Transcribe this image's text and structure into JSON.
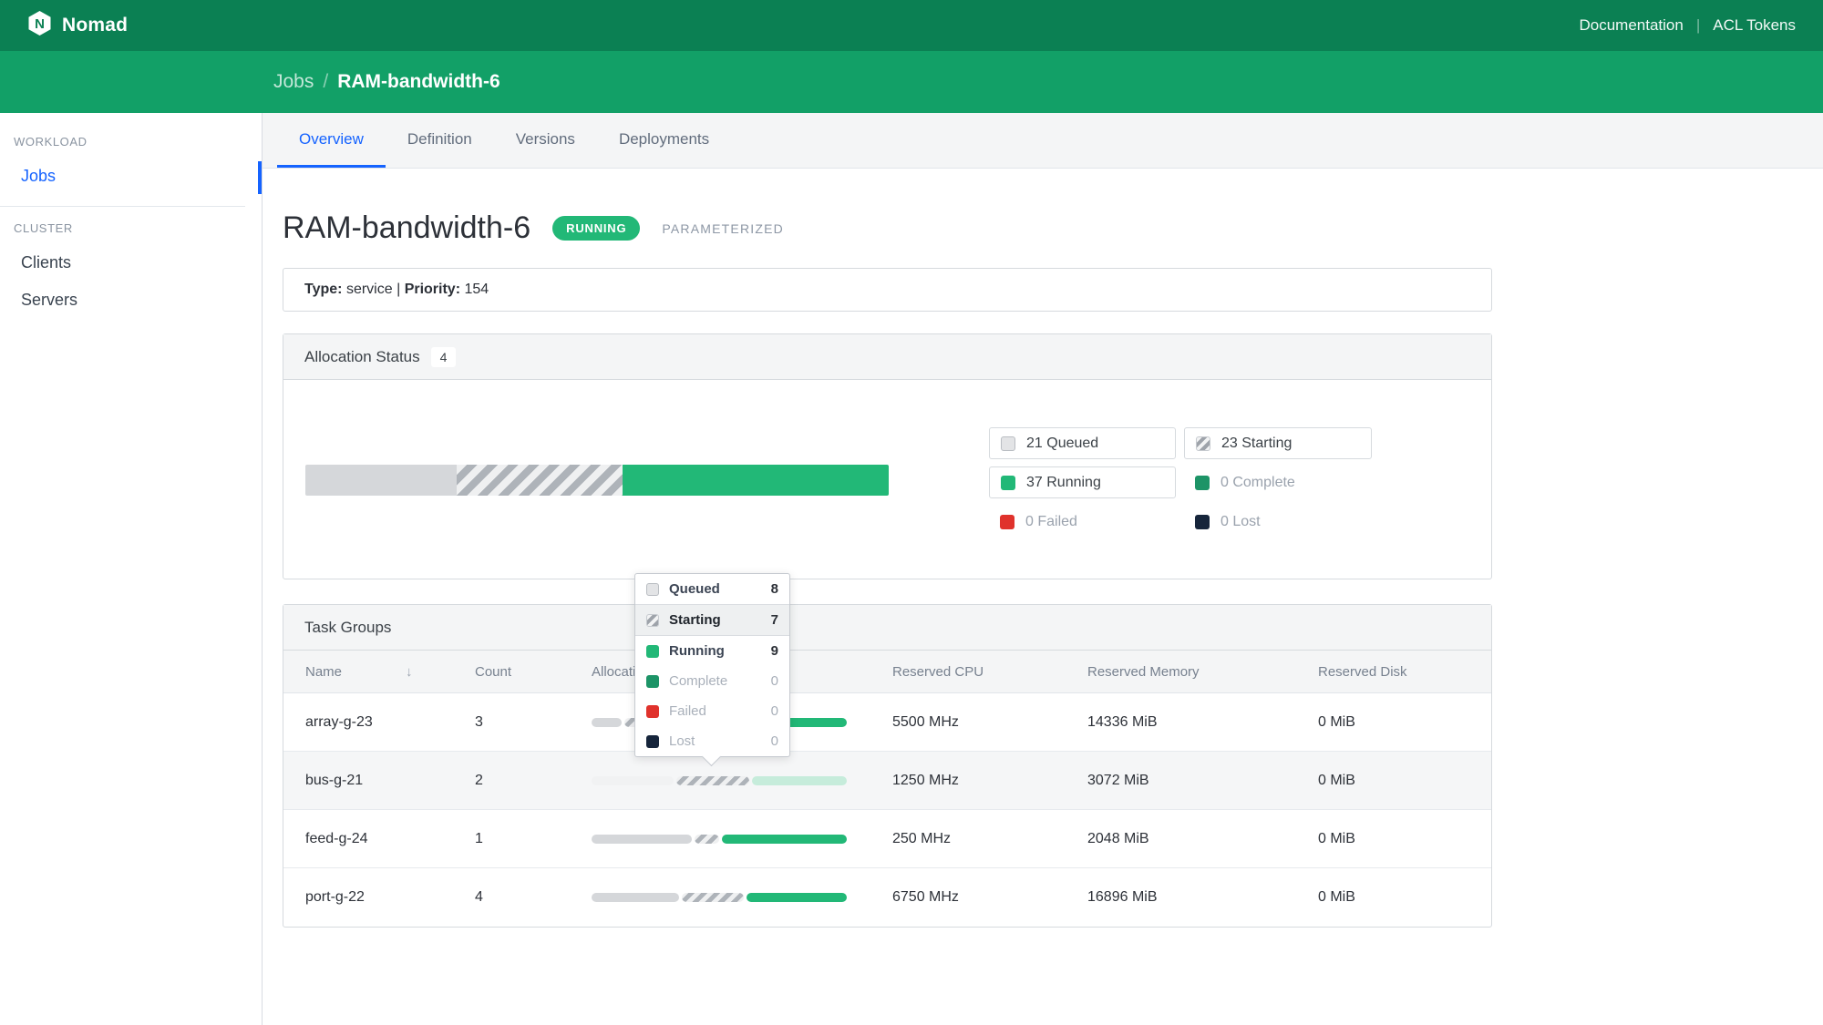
{
  "navbar": {
    "brand": "Nomad",
    "links": [
      {
        "label": "Documentation"
      },
      {
        "label": "ACL Tokens"
      }
    ],
    "separator": "|"
  },
  "breadcrumb": {
    "parent": "Jobs",
    "separator": "/",
    "current": "RAM-bandwidth-6"
  },
  "sidebar": {
    "sections": [
      {
        "label": "WORKLOAD",
        "items": [
          {
            "label": "Jobs",
            "active": true
          }
        ]
      },
      {
        "label": "CLUSTER",
        "items": [
          {
            "label": "Clients"
          },
          {
            "label": "Servers"
          }
        ]
      }
    ]
  },
  "tabs": [
    {
      "label": "Overview",
      "active": true
    },
    {
      "label": "Definition"
    },
    {
      "label": "Versions"
    },
    {
      "label": "Deployments"
    }
  ],
  "job": {
    "title": "RAM-bandwidth-6",
    "status": "RUNNING",
    "tag": "PARAMETERIZED",
    "type_label": "Type:",
    "type_value": "service",
    "meta_separator": "|",
    "priority_label": "Priority:",
    "priority_value": "154"
  },
  "allocation_status": {
    "title": "Allocation Status",
    "badge": "4",
    "chart_data": {
      "type": "bar",
      "stacked": true,
      "total": 81,
      "series": [
        {
          "name": "Queued",
          "value": 21,
          "color": "#d5d7da"
        },
        {
          "name": "Starting",
          "value": 23,
          "color": "striped-gray"
        },
        {
          "name": "Running",
          "value": 37,
          "color": "#22b877"
        },
        {
          "name": "Complete",
          "value": 0,
          "color": "#1d9467"
        },
        {
          "name": "Failed",
          "value": 0,
          "color": "#e0322c"
        },
        {
          "name": "Lost",
          "value": 0,
          "color": "#16253b"
        }
      ]
    },
    "bar": {
      "segments": [
        {
          "type": "queued",
          "pct": 25.9
        },
        {
          "type": "starting",
          "pct": 28.4
        },
        {
          "type": "running",
          "pct": 45.7
        }
      ]
    },
    "legend": [
      {
        "label": "21 Queued"
      },
      {
        "label": "23 Starting"
      },
      {
        "label": "37 Running"
      },
      {
        "label": "0 Complete"
      },
      {
        "label": "0 Failed"
      },
      {
        "label": "0 Lost"
      }
    ]
  },
  "tooltip": {
    "rows": [
      {
        "label": "Queued",
        "count": "8"
      },
      {
        "label": "Starting",
        "count": "7"
      },
      {
        "label": "Running",
        "count": "9"
      },
      {
        "label": "Complete",
        "count": "0"
      },
      {
        "label": "Failed",
        "count": "0"
      },
      {
        "label": "Lost",
        "count": "0"
      }
    ]
  },
  "task_groups": {
    "title": "Task Groups",
    "columns": [
      "Name",
      "Count",
      "Allocation Status",
      "Reserved CPU",
      "Reserved Memory",
      "Reserved Disk"
    ],
    "rows": [
      {
        "name": "array-g-23",
        "count": "3",
        "reserved_cpu": "5500 MHz",
        "reserved_memory": "14336 MiB",
        "reserved_disk": "0 MiB",
        "bar": {
          "segments": [
            {
              "type": "queued",
              "pct": 12
            },
            {
              "type": "starting",
              "pct": 38
            },
            {
              "type": "running",
              "pct": 50
            }
          ]
        }
      },
      {
        "name": "bus-g-21",
        "count": "2",
        "reserved_cpu": "1250 MHz",
        "reserved_memory": "3072 MiB",
        "reserved_disk": "0 MiB",
        "bar": {
          "segments": [
            {
              "type": "queued",
              "pct": 33,
              "faded": true
            },
            {
              "type": "starting",
              "pct": 29
            },
            {
              "type": "running",
              "pct": 38,
              "faded": true
            }
          ]
        }
      },
      {
        "name": "feed-g-24",
        "count": "1",
        "reserved_cpu": "250 MHz",
        "reserved_memory": "2048 MiB",
        "reserved_disk": "0 MiB",
        "bar": {
          "segments": [
            {
              "type": "queued",
              "pct": 40
            },
            {
              "type": "starting",
              "pct": 10
            },
            {
              "type": "running",
              "pct": 50
            }
          ]
        }
      },
      {
        "name": "port-g-22",
        "count": "4",
        "reserved_cpu": "6750 MHz",
        "reserved_memory": "16896 MiB",
        "reserved_disk": "0 MiB",
        "bar": {
          "segments": [
            {
              "type": "queued",
              "pct": 35
            },
            {
              "type": "starting",
              "pct": 25
            },
            {
              "type": "running",
              "pct": 40
            }
          ]
        }
      }
    ]
  },
  "colors": {
    "navbar_green": "#0b8053",
    "subnav_green": "#12a067",
    "accent_blue": "#1563ff",
    "running_green": "#22b877",
    "complete_green": "#1d9467",
    "failed_red": "#e0322c",
    "lost_navy": "#16253b",
    "queued_gray": "#d5d7da"
  }
}
